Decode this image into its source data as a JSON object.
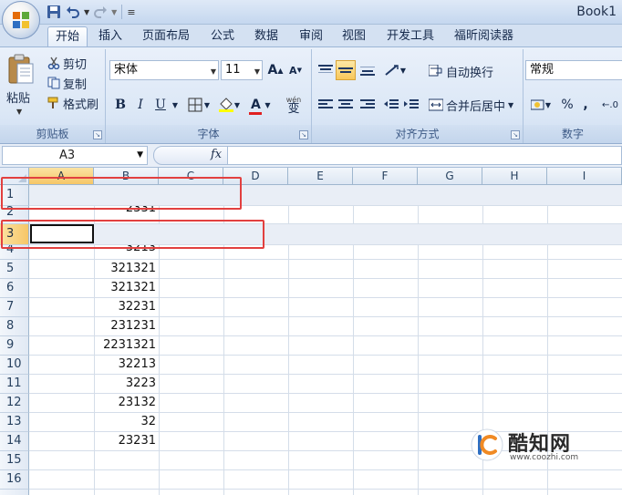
{
  "window": {
    "title": "Book1"
  },
  "tabs": [
    "开始",
    "插入",
    "页面布局",
    "公式",
    "数据",
    "审阅",
    "视图",
    "开发工具",
    "福昕阅读器"
  ],
  "clipboard": {
    "paste": "粘贴",
    "cut": "剪切",
    "copy": "复制",
    "format_painter": "格式刷",
    "label": "剪贴板"
  },
  "font": {
    "name": "宋体",
    "size": "11",
    "grow": "A",
    "shrink": "A",
    "bold": "B",
    "italic": "I",
    "underline": "U",
    "font_color_letter": "A",
    "phonetic": "wén",
    "label": "字体"
  },
  "alignment": {
    "wrap_text": "自动换行",
    "merge_center": "合并后居中",
    "label": "对齐方式"
  },
  "number": {
    "format": "常规",
    "percent": "%",
    "comma": ",",
    "label": "数字"
  },
  "formula_bar": {
    "name_box": "A3",
    "fx": "fx"
  },
  "grid": {
    "columns": [
      "A",
      "B",
      "C",
      "D",
      "E",
      "F",
      "G",
      "H",
      "I"
    ],
    "rows": [
      "1",
      "2",
      "3",
      "4",
      "5",
      "6",
      "7",
      "8",
      "9",
      "10",
      "11",
      "12",
      "13",
      "14",
      "15",
      "16"
    ],
    "b_values": [
      "",
      "2331",
      "",
      "3213",
      "321321",
      "321321",
      "32231",
      "231231",
      "2231321",
      "32213",
      "3223",
      "23132",
      "32",
      "23231",
      "",
      ""
    ]
  },
  "watermark": {
    "brand": "酷知网",
    "url": "www.coozhi.com"
  },
  "colors": {
    "highlight_red": "#e2403f",
    "selection_orange": "#f6c667",
    "ribbon_blue": "#dbe7f6"
  }
}
